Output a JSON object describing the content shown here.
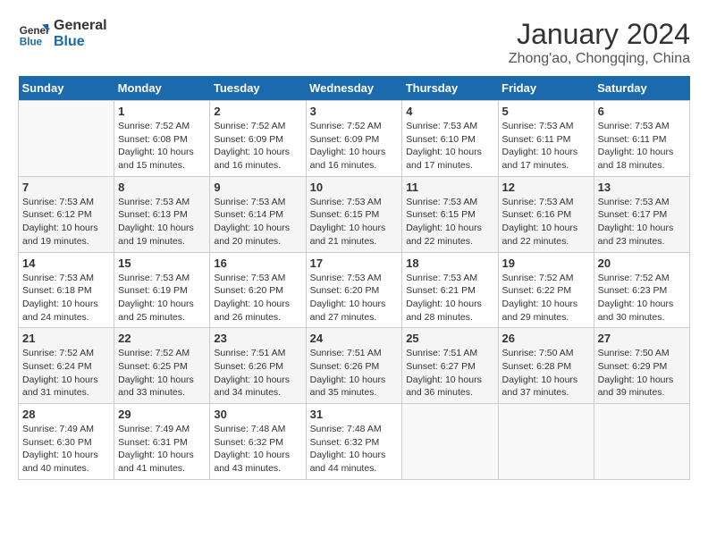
{
  "logo": {
    "line1": "General",
    "line2": "Blue"
  },
  "title": "January 2024",
  "subtitle": "Zhong'ao, Chongqing, China",
  "weekdays": [
    "Sunday",
    "Monday",
    "Tuesday",
    "Wednesday",
    "Thursday",
    "Friday",
    "Saturday"
  ],
  "weeks": [
    [
      {
        "day": "",
        "info": ""
      },
      {
        "day": "1",
        "info": "Sunrise: 7:52 AM\nSunset: 6:08 PM\nDaylight: 10 hours\nand 15 minutes."
      },
      {
        "day": "2",
        "info": "Sunrise: 7:52 AM\nSunset: 6:09 PM\nDaylight: 10 hours\nand 16 minutes."
      },
      {
        "day": "3",
        "info": "Sunrise: 7:52 AM\nSunset: 6:09 PM\nDaylight: 10 hours\nand 16 minutes."
      },
      {
        "day": "4",
        "info": "Sunrise: 7:53 AM\nSunset: 6:10 PM\nDaylight: 10 hours\nand 17 minutes."
      },
      {
        "day": "5",
        "info": "Sunrise: 7:53 AM\nSunset: 6:11 PM\nDaylight: 10 hours\nand 17 minutes."
      },
      {
        "day": "6",
        "info": "Sunrise: 7:53 AM\nSunset: 6:11 PM\nDaylight: 10 hours\nand 18 minutes."
      }
    ],
    [
      {
        "day": "7",
        "info": "Sunrise: 7:53 AM\nSunset: 6:12 PM\nDaylight: 10 hours\nand 19 minutes."
      },
      {
        "day": "8",
        "info": "Sunrise: 7:53 AM\nSunset: 6:13 PM\nDaylight: 10 hours\nand 19 minutes."
      },
      {
        "day": "9",
        "info": "Sunrise: 7:53 AM\nSunset: 6:14 PM\nDaylight: 10 hours\nand 20 minutes."
      },
      {
        "day": "10",
        "info": "Sunrise: 7:53 AM\nSunset: 6:15 PM\nDaylight: 10 hours\nand 21 minutes."
      },
      {
        "day": "11",
        "info": "Sunrise: 7:53 AM\nSunset: 6:15 PM\nDaylight: 10 hours\nand 22 minutes."
      },
      {
        "day": "12",
        "info": "Sunrise: 7:53 AM\nSunset: 6:16 PM\nDaylight: 10 hours\nand 22 minutes."
      },
      {
        "day": "13",
        "info": "Sunrise: 7:53 AM\nSunset: 6:17 PM\nDaylight: 10 hours\nand 23 minutes."
      }
    ],
    [
      {
        "day": "14",
        "info": "Sunrise: 7:53 AM\nSunset: 6:18 PM\nDaylight: 10 hours\nand 24 minutes."
      },
      {
        "day": "15",
        "info": "Sunrise: 7:53 AM\nSunset: 6:19 PM\nDaylight: 10 hours\nand 25 minutes."
      },
      {
        "day": "16",
        "info": "Sunrise: 7:53 AM\nSunset: 6:20 PM\nDaylight: 10 hours\nand 26 minutes."
      },
      {
        "day": "17",
        "info": "Sunrise: 7:53 AM\nSunset: 6:20 PM\nDaylight: 10 hours\nand 27 minutes."
      },
      {
        "day": "18",
        "info": "Sunrise: 7:53 AM\nSunset: 6:21 PM\nDaylight: 10 hours\nand 28 minutes."
      },
      {
        "day": "19",
        "info": "Sunrise: 7:52 AM\nSunset: 6:22 PM\nDaylight: 10 hours\nand 29 minutes."
      },
      {
        "day": "20",
        "info": "Sunrise: 7:52 AM\nSunset: 6:23 PM\nDaylight: 10 hours\nand 30 minutes."
      }
    ],
    [
      {
        "day": "21",
        "info": "Sunrise: 7:52 AM\nSunset: 6:24 PM\nDaylight: 10 hours\nand 31 minutes."
      },
      {
        "day": "22",
        "info": "Sunrise: 7:52 AM\nSunset: 6:25 PM\nDaylight: 10 hours\nand 33 minutes."
      },
      {
        "day": "23",
        "info": "Sunrise: 7:51 AM\nSunset: 6:26 PM\nDaylight: 10 hours\nand 34 minutes."
      },
      {
        "day": "24",
        "info": "Sunrise: 7:51 AM\nSunset: 6:26 PM\nDaylight: 10 hours\nand 35 minutes."
      },
      {
        "day": "25",
        "info": "Sunrise: 7:51 AM\nSunset: 6:27 PM\nDaylight: 10 hours\nand 36 minutes."
      },
      {
        "day": "26",
        "info": "Sunrise: 7:50 AM\nSunset: 6:28 PM\nDaylight: 10 hours\nand 37 minutes."
      },
      {
        "day": "27",
        "info": "Sunrise: 7:50 AM\nSunset: 6:29 PM\nDaylight: 10 hours\nand 39 minutes."
      }
    ],
    [
      {
        "day": "28",
        "info": "Sunrise: 7:49 AM\nSunset: 6:30 PM\nDaylight: 10 hours\nand 40 minutes."
      },
      {
        "day": "29",
        "info": "Sunrise: 7:49 AM\nSunset: 6:31 PM\nDaylight: 10 hours\nand 41 minutes."
      },
      {
        "day": "30",
        "info": "Sunrise: 7:48 AM\nSunset: 6:32 PM\nDaylight: 10 hours\nand 43 minutes."
      },
      {
        "day": "31",
        "info": "Sunrise: 7:48 AM\nSunset: 6:32 PM\nDaylight: 10 hours\nand 44 minutes."
      },
      {
        "day": "",
        "info": ""
      },
      {
        "day": "",
        "info": ""
      },
      {
        "day": "",
        "info": ""
      }
    ]
  ]
}
